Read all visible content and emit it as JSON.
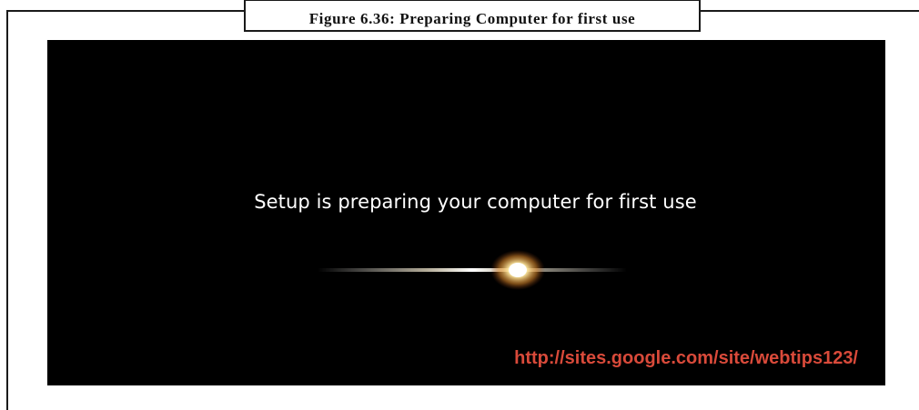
{
  "figure": {
    "caption": "Figure 6.36: Preparing Computer for first use"
  },
  "screen": {
    "message": "Setup is preparing your computer for first use",
    "watermark_url": "http://sites.google.com/site/webtips123/",
    "watermark_color": "#d94a3a",
    "background_color": "#000000",
    "glow_icon": "light-flare-icon"
  }
}
